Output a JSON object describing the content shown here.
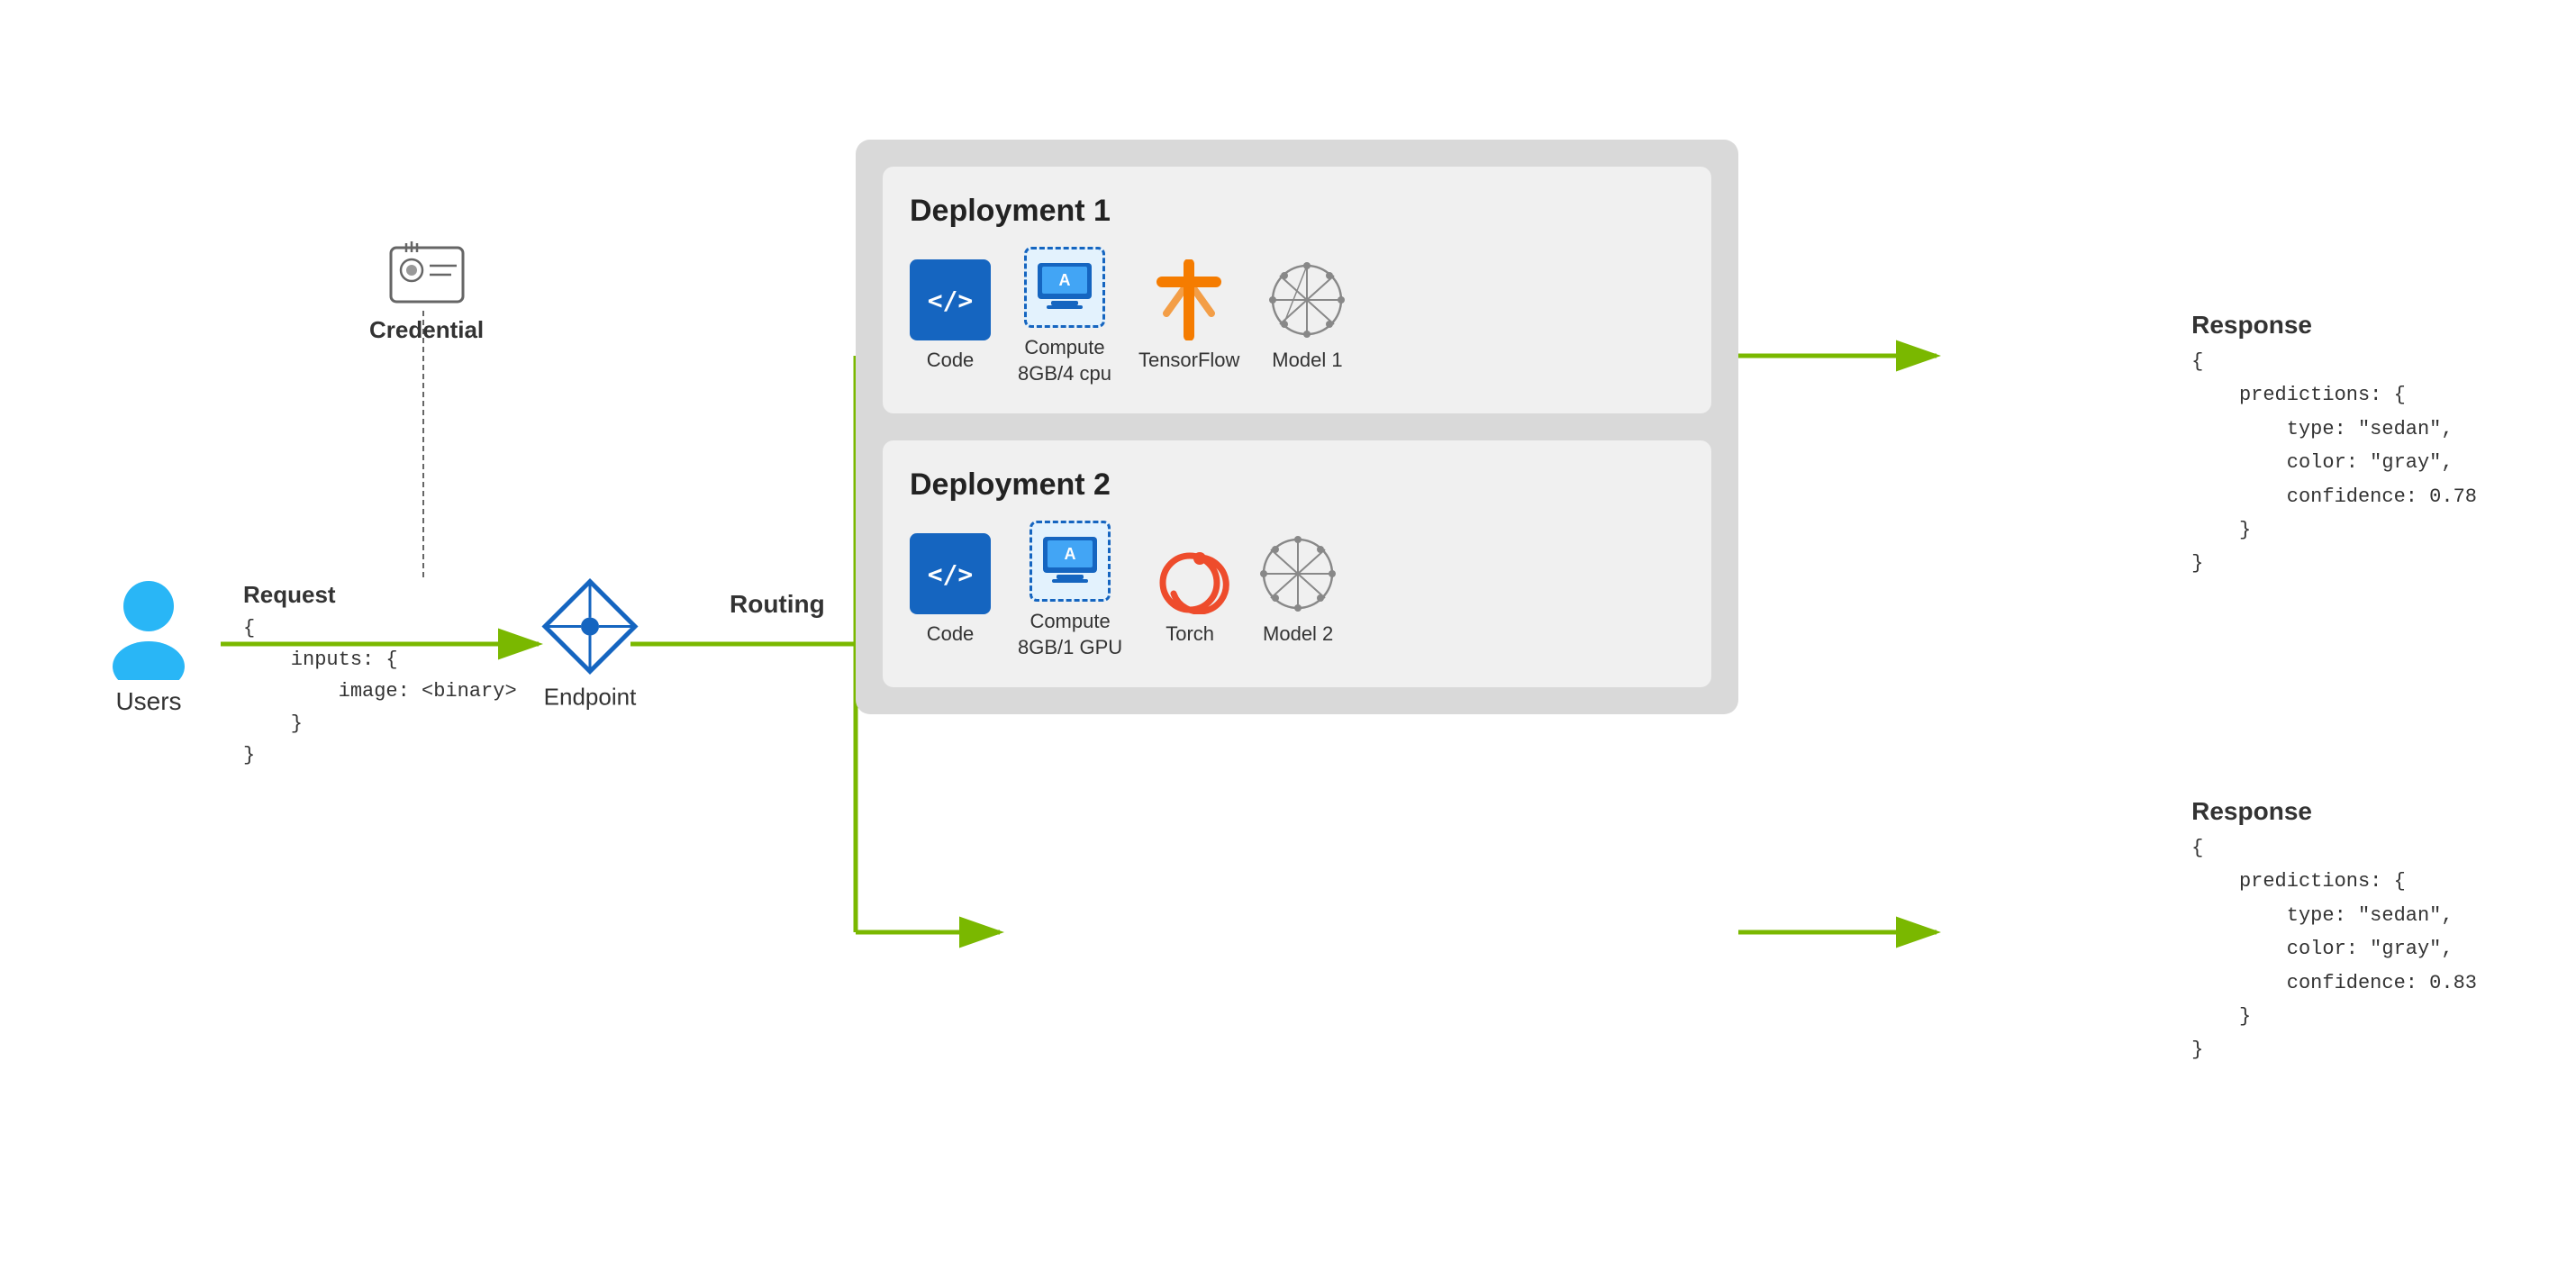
{
  "user": {
    "label": "Users"
  },
  "credential": {
    "label": "Credential"
  },
  "request": {
    "label": "Request",
    "code_line1": "{",
    "code_line2": "    inputs: {",
    "code_line3": "        image: <binary>",
    "code_line4": "    }",
    "code_line5": "}"
  },
  "endpoint": {
    "label": "Endpoint"
  },
  "routing": {
    "label": "Routing"
  },
  "deployment1": {
    "title": "Deployment 1",
    "code_label": "Code",
    "compute_label": "Compute\n8GB/4 cpu",
    "framework_label": "TensorFlow",
    "model_label": "Model 1"
  },
  "deployment2": {
    "title": "Deployment 2",
    "code_label": "Code",
    "compute_label": "Compute\n8GB/1 GPU",
    "framework_label": "Torch",
    "model_label": "Model 2"
  },
  "response1": {
    "label": "Response",
    "code": "{\n    predictions: {\n        type: \"sedan\",\n        color: \"gray\",\n        confidence: 0.78\n    }\n}"
  },
  "response2": {
    "label": "Response",
    "code": "{\n    predictions: {\n        type: \"sedan\",\n        color: \"gray\",\n        confidence: 0.83\n    }\n}"
  },
  "colors": {
    "arrow": "#7ab800",
    "blue_dark": "#1565c0",
    "blue_light": "#29b6f6",
    "orange": "#f57c00",
    "torch_red": "#ee4b2b",
    "gray": "#999999"
  }
}
